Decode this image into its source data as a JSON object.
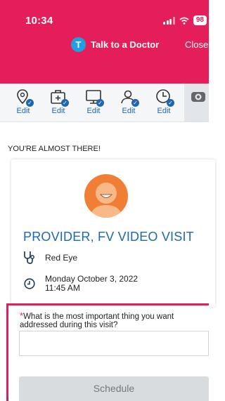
{
  "status_bar": {
    "time": "10:34",
    "battery": "98"
  },
  "header": {
    "avatar_initial": "T",
    "title": "Talk to a Doctor",
    "close_label": "Close"
  },
  "steps": [
    {
      "icon": "location-pin-icon",
      "label": "Edit"
    },
    {
      "icon": "medical-kit-icon",
      "label": "Edit"
    },
    {
      "icon": "monitor-icon",
      "label": "Edit"
    },
    {
      "icon": "person-icon",
      "label": "Edit"
    },
    {
      "icon": "clock-icon",
      "label": "Edit"
    },
    {
      "icon": "video-camera-icon",
      "label": ""
    }
  ],
  "main": {
    "heading": "YOU'RE ALMOST THERE!",
    "provider_name": "PROVIDER, FV VIDEO VISIT",
    "reason": "Red Eye",
    "date_line1": "Monday October 3, 2022",
    "date_line2": "11:45 AM"
  },
  "form": {
    "required_marker": "*",
    "question": "What is the most important thing you want addressed during this visit?",
    "answer_value": "",
    "schedule_label": "Schedule"
  }
}
